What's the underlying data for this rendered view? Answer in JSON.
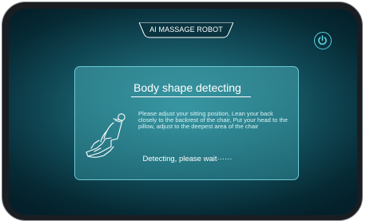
{
  "header": {
    "title": "AI MASSAGE ROBOT"
  },
  "power": {
    "icon": "power-icon"
  },
  "panel": {
    "title": "Body shape detecting",
    "instructions": "Please adjust your sitting position, Lean your back closely to the backrest of the chair, Put your head to the pillow, adjust to the deepest area of the chair",
    "status": "Detecting, please wait······",
    "icon": "massage-chair-icon"
  },
  "colors": {
    "accent": "#58d3e0",
    "panel_border": "#6cc9d3",
    "background": "#0f4552"
  }
}
